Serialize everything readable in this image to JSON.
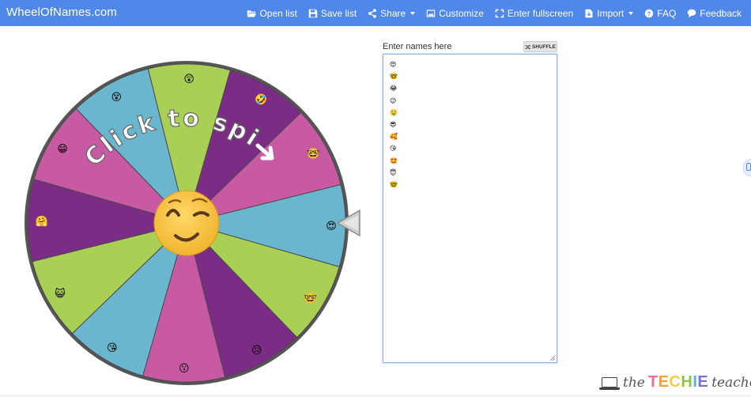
{
  "navbar": {
    "brand": "WheelOfNames.com",
    "items": [
      {
        "label": "Open list",
        "icon": "folder-open-icon"
      },
      {
        "label": "Save list",
        "icon": "save-icon"
      },
      {
        "label": "Share",
        "icon": "share-icon",
        "dropdown": true
      },
      {
        "label": "Customize",
        "icon": "image-icon"
      },
      {
        "label": "Enter fullscreen",
        "icon": "fullscreen-icon"
      },
      {
        "label": "Import",
        "icon": "import-icon",
        "dropdown": true
      },
      {
        "label": "FAQ",
        "icon": "question-icon"
      },
      {
        "label": "Feedback",
        "icon": "comment-icon"
      }
    ]
  },
  "wheel": {
    "spin_text": "Click to spin",
    "center_emoji": "😉",
    "segment_colors": [
      "#7b2c85",
      "#c75aa2",
      "#6bb6cf",
      "#a9cf54"
    ],
    "slices": [
      {
        "emoji": "😍"
      },
      {
        "emoji": "🤓"
      },
      {
        "emoji": "😥"
      },
      {
        "emoji": "😗"
      },
      {
        "emoji": "😘"
      },
      {
        "emoji": "😺"
      },
      {
        "emoji": "🤗"
      },
      {
        "emoji": "😁"
      },
      {
        "emoji": "😵"
      },
      {
        "emoji": "😲"
      },
      {
        "emoji": "🤣"
      },
      {
        "emoji": "🤓"
      }
    ]
  },
  "names_panel": {
    "label": "Enter names here",
    "shuffle_label": "SHUFFLE",
    "names": [
      "😍",
      "🤓",
      "😂",
      "😉",
      "🤤",
      "😎",
      "🥰",
      "😘",
      "🤩",
      "😇",
      "🤓"
    ]
  },
  "branding": {
    "pre": "the",
    "main": "TECHIE",
    "post": "teacher",
    "techie_colors": [
      "#f06aa0",
      "#f2a33a",
      "#f4cf3c",
      "#8cc63f",
      "#4fb6e3",
      "#7b6fd6"
    ]
  }
}
